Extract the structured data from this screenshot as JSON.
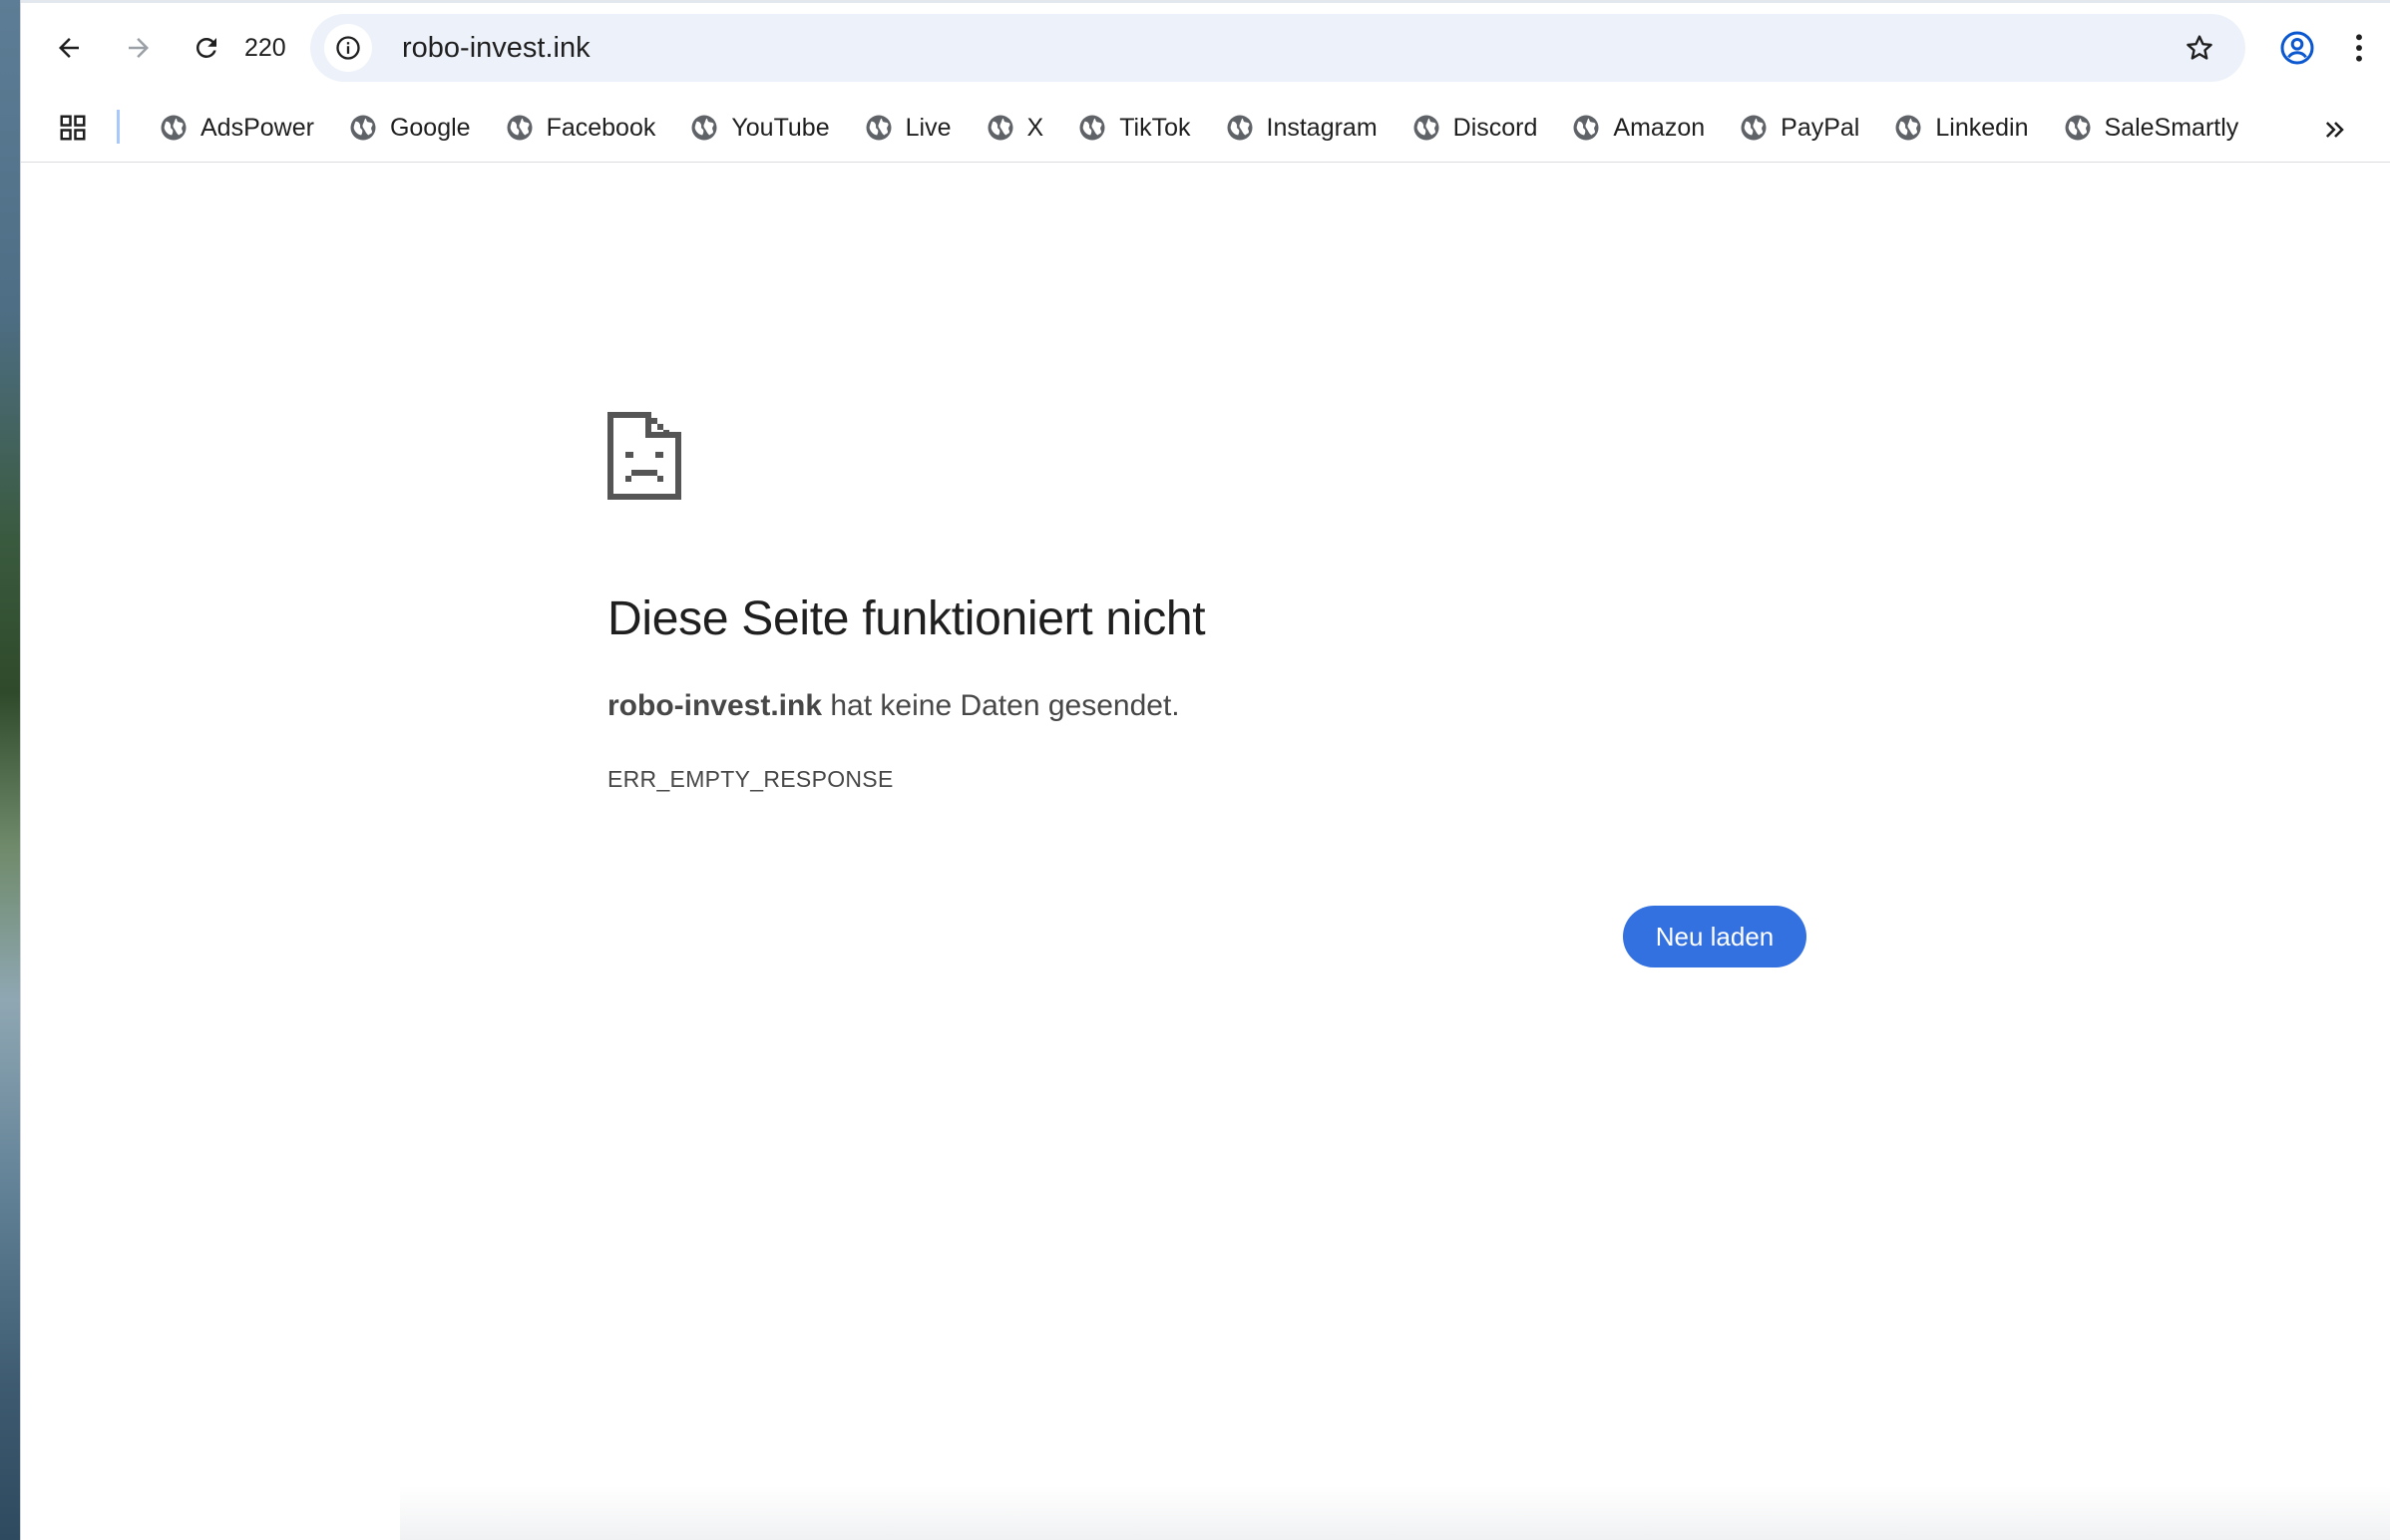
{
  "toolbar": {
    "reload_count": "220",
    "url": "robo-invest.ink"
  },
  "bookmarks": {
    "items": [
      {
        "label": "AdsPower"
      },
      {
        "label": "Google"
      },
      {
        "label": "Facebook"
      },
      {
        "label": "YouTube"
      },
      {
        "label": "Live"
      },
      {
        "label": "X"
      },
      {
        "label": "TikTok"
      },
      {
        "label": "Instagram"
      },
      {
        "label": "Discord"
      },
      {
        "label": "Amazon"
      },
      {
        "label": "PayPal"
      },
      {
        "label": "Linkedin"
      },
      {
        "label": "SaleSmartly"
      }
    ]
  },
  "error": {
    "title": "Diese Seite funktioniert nicht",
    "host": "robo-invest.ink",
    "message": " hat keine Daten gesendet.",
    "code": "ERR_EMPTY_RESPONSE",
    "reload_label": "Neu laden"
  },
  "colors": {
    "accent": "#3370e0",
    "omnibox_bg": "#edf2fa",
    "text": "#1f1f1f",
    "secondary_text": "#474747"
  }
}
